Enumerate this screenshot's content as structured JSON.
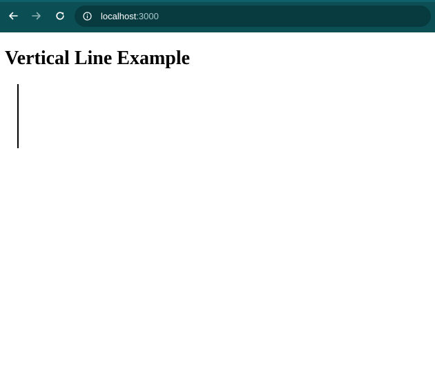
{
  "browser": {
    "url_host": "localhost",
    "url_port": ":3000",
    "icons": {
      "back": "back-arrow-icon",
      "forward": "forward-arrow-icon",
      "reload": "reload-icon",
      "site_info": "info-icon"
    },
    "colors": {
      "toolbar": "#0b4e54",
      "address_bar": "#073b40"
    }
  },
  "page": {
    "heading": "Vertical Line Example",
    "line_color": "#000000"
  }
}
